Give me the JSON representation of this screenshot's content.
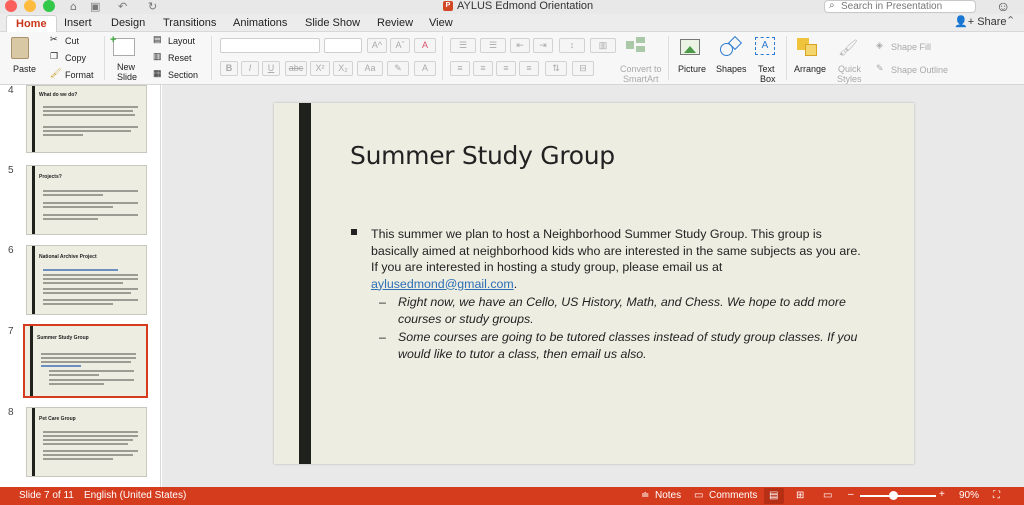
{
  "window": {
    "title": "AYLUS Edmond Orientation",
    "search_placeholder": "Search in Presentation"
  },
  "tabs": [
    "Home",
    "Insert",
    "Design",
    "Transitions",
    "Animations",
    "Slide Show",
    "Review",
    "View"
  ],
  "active_tab": "Home",
  "share_label": "Share",
  "ribbon": {
    "paste": "Paste",
    "cut": "Cut",
    "copy": "Copy",
    "format": "Format",
    "new_slide_line1": "New",
    "new_slide_line2": "Slide",
    "layout": "Layout",
    "reset": "Reset",
    "section": "Section",
    "convert_line1": "Convert to",
    "convert_line2": "SmartArt",
    "picture": "Picture",
    "shapes": "Shapes",
    "textbox_line1": "Text",
    "textbox_line2": "Box",
    "arrange": "Arrange",
    "quick_line1": "Quick",
    "quick_line2": "Styles",
    "shape_fill": "Shape Fill",
    "shape_outline": "Shape Outline",
    "bold": "B",
    "italic": "I",
    "underline": "U",
    "strike": "abc",
    "superscript": "X²",
    "subscript": "X₂",
    "grow_font": "A^",
    "shrink_font": "Aˇ",
    "clear_format": "A",
    "font_color": "A",
    "change_case": "Aa"
  },
  "thumbnails": [
    {
      "number": "4",
      "title": "What do we do?",
      "selected": false
    },
    {
      "number": "5",
      "title": "Projects?",
      "selected": false
    },
    {
      "number": "6",
      "title": "National Archive Project",
      "selected": false
    },
    {
      "number": "7",
      "title": "Summer Study Group",
      "selected": true
    },
    {
      "number": "8",
      "title": "Pet Care Group",
      "selected": false
    }
  ],
  "slide": {
    "title": "Summer Study Group",
    "bullet_text": "This summer we plan to host a Neighborhood Summer Study Group. This group is basically aimed at neighborhood kids who are interested in the same subjects as you are. If you are interested in hosting a study group, please email us at ",
    "email": "aylusedmond@gmail.com",
    "bullet_end": ".",
    "sub_bullets": [
      "Right now, we have an Cello, US History, Math, and Chess. We hope to add more courses or study groups.",
      "Some courses are going to be tutored classes instead of study group classes. If you would like to tutor a class, then email us also."
    ]
  },
  "status": {
    "slide_of": "Slide 7 of 11",
    "language": "English (United States)",
    "notes": "Notes",
    "comments": "Comments",
    "zoom_percent": "90%",
    "zoom_minus": "–",
    "zoom_plus": "+"
  },
  "colors": {
    "accent": "#d53c1e",
    "slide_bg": "#eeede2",
    "slide_bar": "#1e211c",
    "link": "#2d6fb5"
  },
  "zoom_level": 0.9
}
